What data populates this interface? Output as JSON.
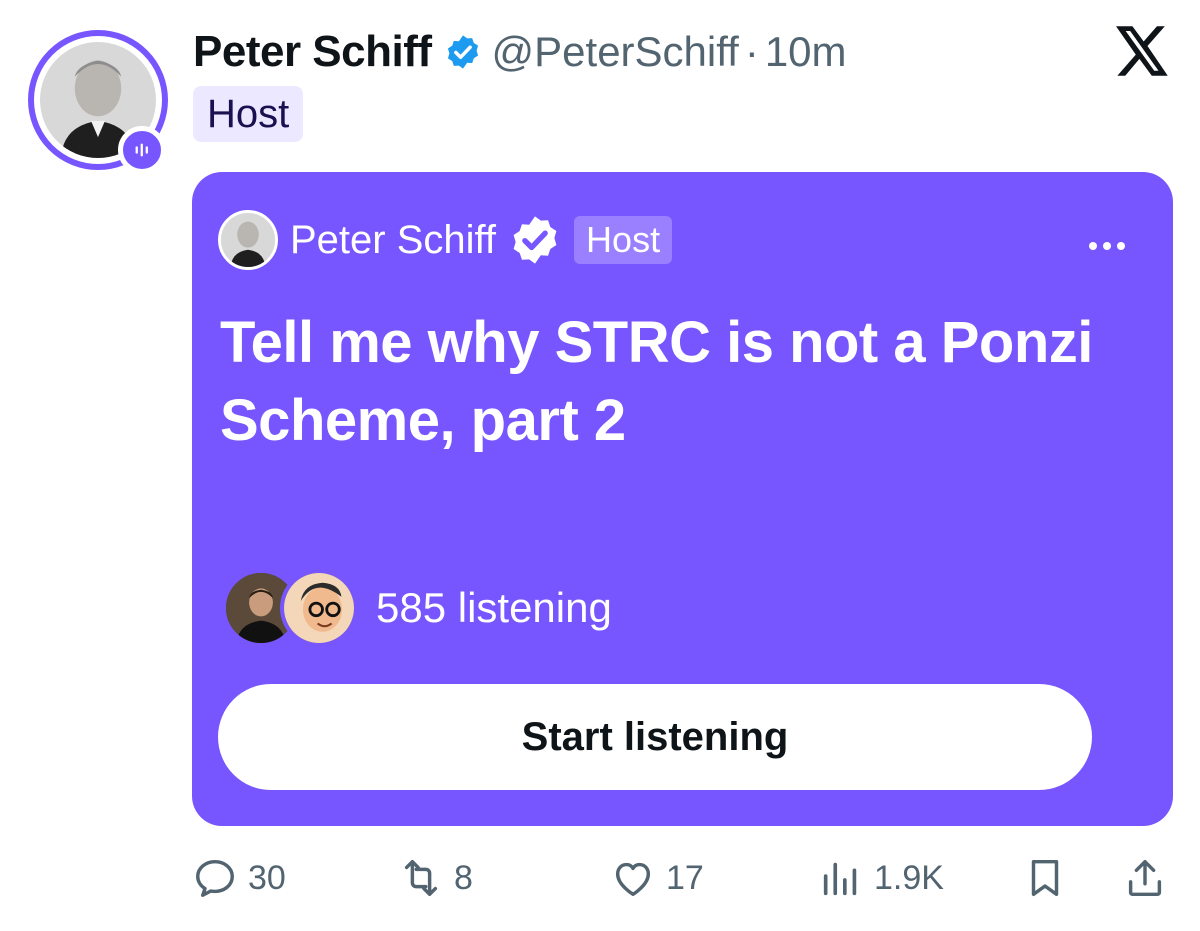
{
  "tweet": {
    "display_name": "Peter Schiff",
    "handle": "@PeterSchiff",
    "separator": "·",
    "time": "10m",
    "host_tag": "Host",
    "platform_logo": "x-logo"
  },
  "space": {
    "host_name": "Peter Schiff",
    "host_tag": "Host",
    "title": "Tell me why STRC is not a Ponzi Scheme, part 2",
    "listening": "585 listening",
    "start_button": "Start listening",
    "accent_color": "#7856ff"
  },
  "actions": {
    "replies": "30",
    "reposts": "8",
    "likes": "17",
    "views": "1.9K"
  },
  "icons": {
    "verified": "verified-badge-icon",
    "reply": "reply-icon",
    "repost": "repost-icon",
    "like": "heart-icon",
    "views": "views-icon",
    "bookmark": "bookmark-icon",
    "share": "share-icon"
  }
}
